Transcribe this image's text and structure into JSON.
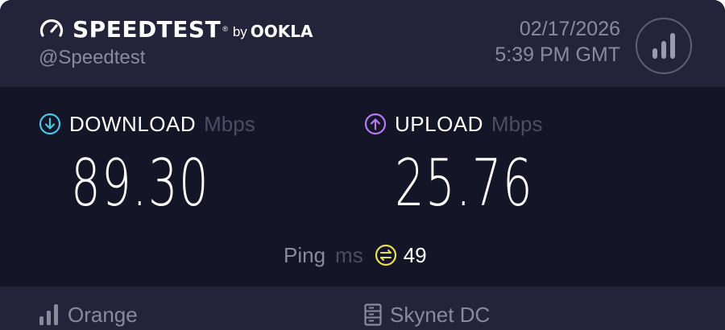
{
  "header": {
    "brand": "SPEEDTEST",
    "trademark": "®",
    "by": "by",
    "ookla": "OOKLA",
    "handle": "@Speedtest",
    "date": "02/17/2026",
    "time": "5:39 PM GMT"
  },
  "download": {
    "label": "DOWNLOAD",
    "unit": "Mbps",
    "value": "89.30",
    "color": "#49c6e5",
    "icon": "download-arrow-icon"
  },
  "upload": {
    "label": "UPLOAD",
    "unit": "Mbps",
    "value": "25.76",
    "color": "#b57bf3",
    "icon": "upload-arrow-icon"
  },
  "ping": {
    "label": "Ping",
    "unit": "ms",
    "value": "49",
    "color": "#e8e05a",
    "icon": "ping-icon"
  },
  "footer": {
    "isp": "Orange",
    "isp_icon": "signal-bars-icon",
    "server": "Skynet DC",
    "server_icon": "server-icon"
  },
  "colors": {
    "background": "#151528",
    "panel": "#23233a",
    "muted_text": "#8a8a9e",
    "dim_text": "#4d4d62"
  }
}
